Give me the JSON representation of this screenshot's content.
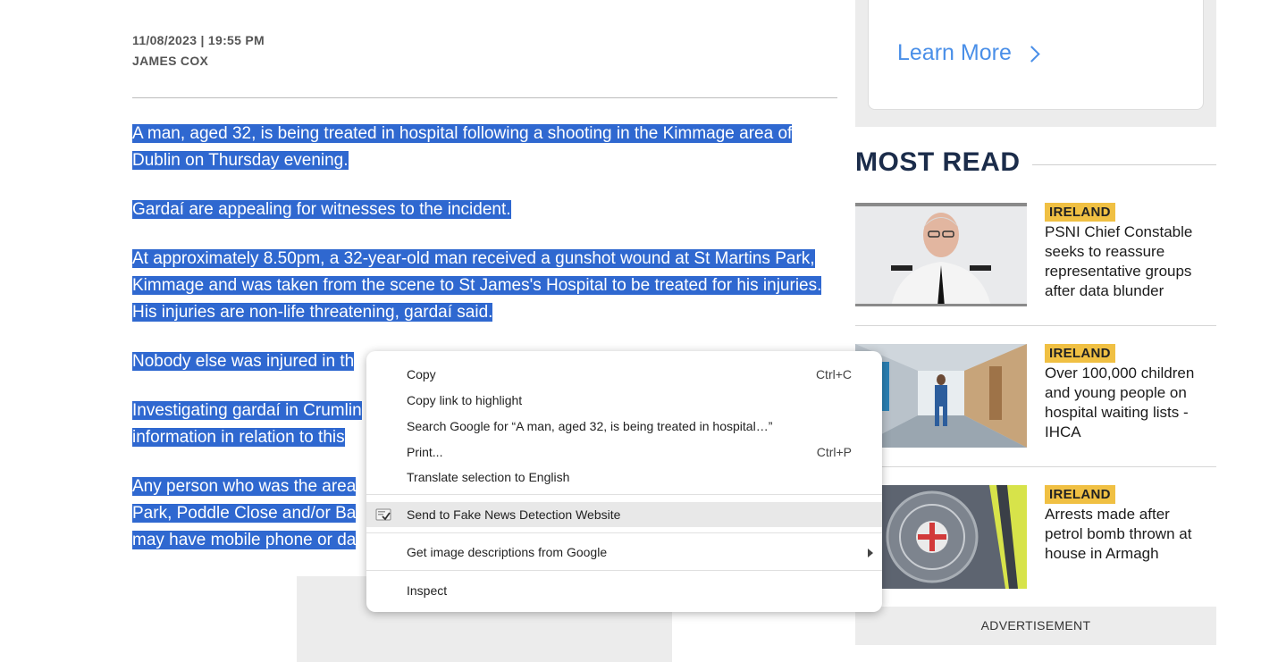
{
  "article": {
    "date": "11/08/2023 | 19:55 PM",
    "author": "JAMES COX",
    "paragraphs": [
      "A man, aged 32, is being treated in hospital following a shooting in the Kimmage area of Dublin on Thursday evening.",
      "Gardaí are appealing for witnesses to the incident.",
      "At approximately 8.50pm, a 32-year-old man received a gunshot wound at St Martins Park, Kimmage and was taken from the scene to St James's Hospital to be treated for his injuries. His injuries are non-life threatening, gardaí said.",
      "Nobody else was injured in th",
      "Investigating gardaí in Crumlin",
      "information in relation to this",
      "Any person who was the area",
      "Park, Poddle Close and/or Ba",
      "may have mobile phone or da"
    ]
  },
  "sidebar": {
    "learn_more": "Learn More",
    "most_read_title": "MOST READ",
    "stories": [
      {
        "tag": "IRELAND",
        "headline": "PSNI Chief Constable seeks to reassure representative groups after data blunder"
      },
      {
        "tag": "IRELAND",
        "headline": "Over 100,000 children and young people on hospital waiting lists - IHCA"
      },
      {
        "tag": "IRELAND",
        "headline": "Arrests made after petrol bomb thrown at house in Armagh"
      }
    ],
    "advertisement": "ADVERTISEMENT"
  },
  "context_menu": {
    "items": [
      {
        "label": "Copy",
        "shortcut": "Ctrl+C"
      },
      {
        "label": "Copy link to highlight",
        "shortcut": ""
      },
      {
        "label": "Search Google for “A man, aged 32, is being treated in hospital…”",
        "shortcut": ""
      },
      {
        "label": "Print...",
        "shortcut": "Ctrl+P"
      },
      {
        "label": "Translate selection to English",
        "shortcut": ""
      },
      {
        "label": "Send to Fake News Detection Website",
        "shortcut": ""
      },
      {
        "label": "Get image descriptions from Google",
        "shortcut": ""
      },
      {
        "label": "Inspect",
        "shortcut": ""
      }
    ]
  },
  "colors": {
    "selection": "#2f68d0",
    "badge": "#f0c043",
    "link": "#4a8fe8",
    "heading": "#1b2c4a"
  }
}
